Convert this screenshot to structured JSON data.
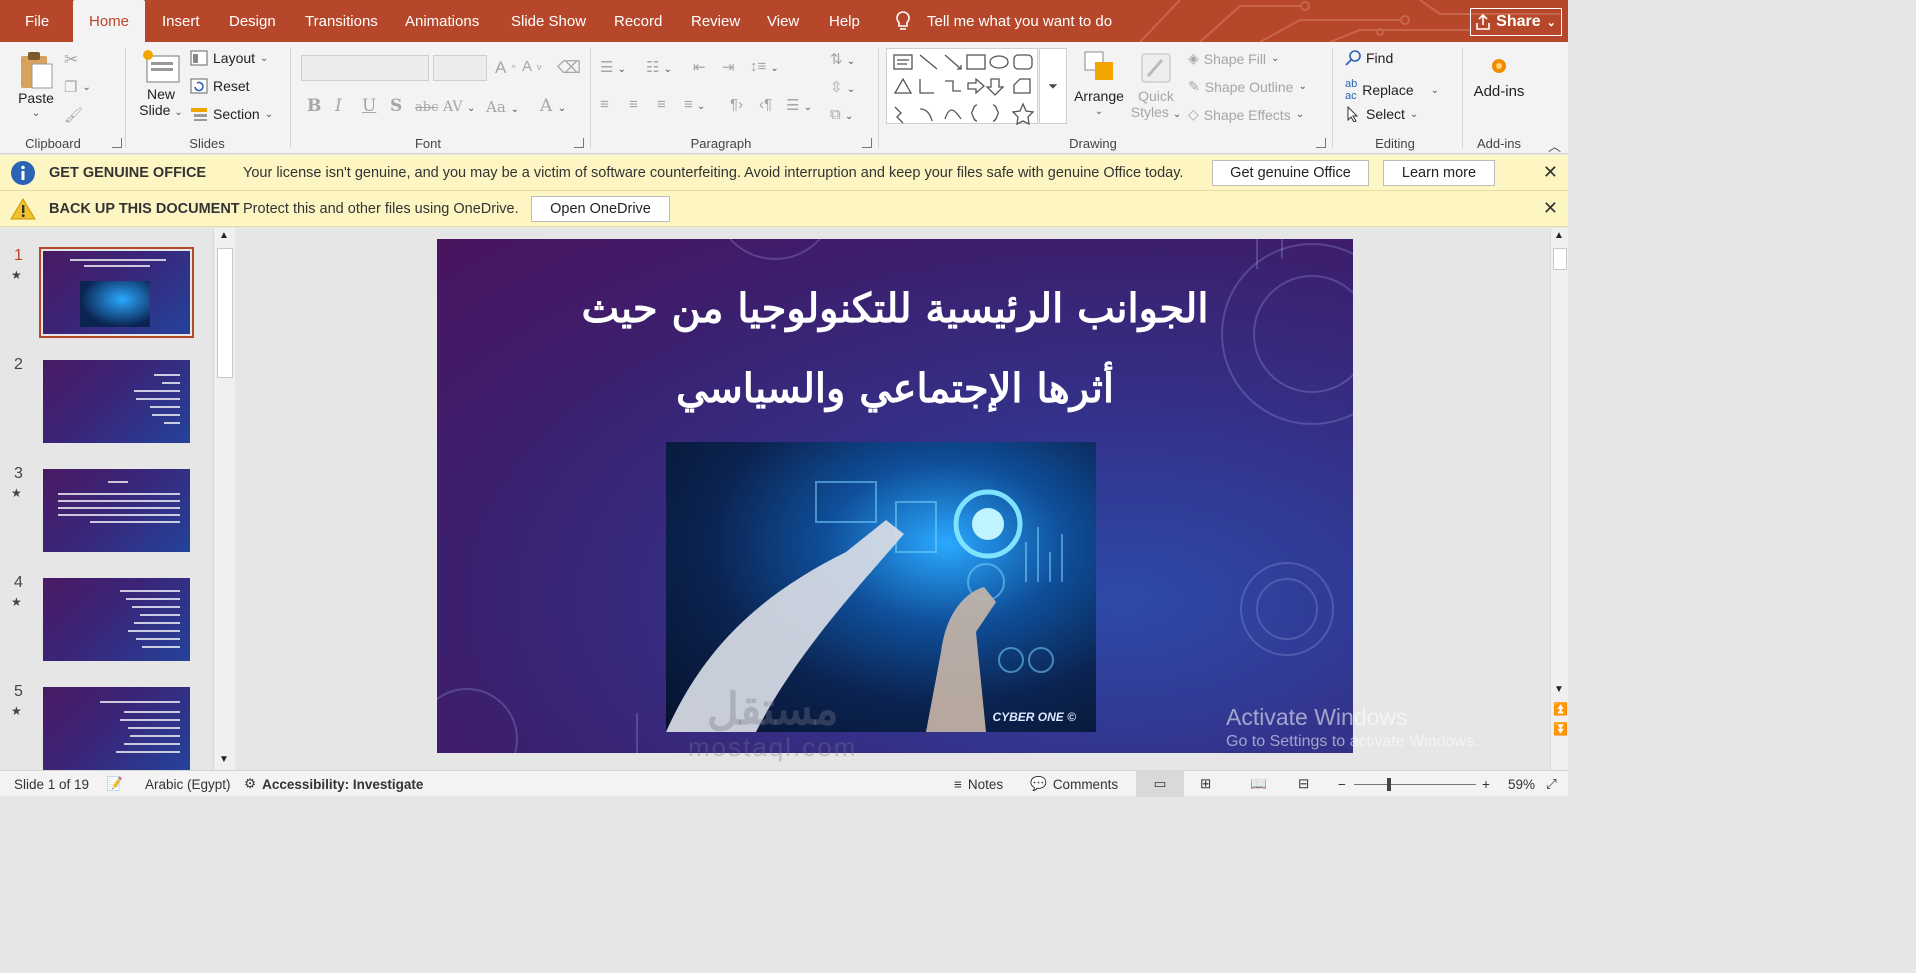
{
  "tabs": {
    "file": "File",
    "home": "Home",
    "insert": "Insert",
    "design": "Design",
    "transitions": "Transitions",
    "animations": "Animations",
    "slide_show": "Slide Show",
    "record": "Record",
    "review": "Review",
    "view": "View",
    "help": "Help"
  },
  "tell_me": "Tell me what you want to do",
  "share": "Share",
  "ribbon": {
    "clipboard": {
      "paste": "Paste",
      "label": "Clipboard"
    },
    "slides": {
      "new_slide_1": "New",
      "new_slide_2": "Slide",
      "layout": "Layout",
      "reset": "Reset",
      "section": "Section",
      "label": "Slides"
    },
    "font": {
      "label": "Font",
      "bold": "B",
      "italic": "I",
      "underline": "U",
      "shadow": "S",
      "strike": "abc",
      "spacing": "AV",
      "case": "Aa",
      "grow": "A",
      "shrink": "A",
      "color": "A"
    },
    "paragraph": {
      "label": "Paragraph"
    },
    "drawing": {
      "arrange": "Arrange",
      "quick_styles_1": "Quick",
      "quick_styles_2": "Styles",
      "shape_fill": "Shape Fill",
      "shape_outline": "Shape Outline",
      "shape_effects": "Shape Effects",
      "label": "Drawing"
    },
    "editing": {
      "find": "Find",
      "replace": "Replace",
      "select": "Select",
      "label": "Editing"
    },
    "addins": {
      "addins": "Add-ins",
      "label": "Add-ins"
    }
  },
  "msgbar_genuine": {
    "title": "GET GENUINE OFFICE",
    "text": "Your license isn't genuine, and you may be a victim of software counterfeiting. Avoid interruption and keep your files safe with genuine Office today.",
    "btn1": "Get genuine Office",
    "btn2": "Learn more"
  },
  "msgbar_backup": {
    "title": "BACK UP THIS DOCUMENT",
    "text": "Protect this and other files using OneDrive.",
    "btn": "Open OneDrive"
  },
  "thumbnails": [
    "1",
    "2",
    "3",
    "4",
    "5"
  ],
  "slide": {
    "title_line1": "الجوانب الرئيسية للتكنولوجيا من حيث",
    "title_line2": "أثرها الإجتماعي والسياسي",
    "photo_caption": "CYBER ONE ©"
  },
  "watermark": {
    "ar": "مستقل",
    "en": "mostaql.com"
  },
  "activate": {
    "heading": "Activate Windows",
    "sub": "Go to Settings to activate Windows."
  },
  "status": {
    "slide": "Slide 1 of 19",
    "language": "Arabic (Egypt)",
    "accessibility": "Accessibility: Investigate",
    "notes": "Notes",
    "comments": "Comments",
    "zoom": "59%"
  },
  "colors": {
    "accent": "#b7472a",
    "msgbar": "#fdf6c3"
  }
}
